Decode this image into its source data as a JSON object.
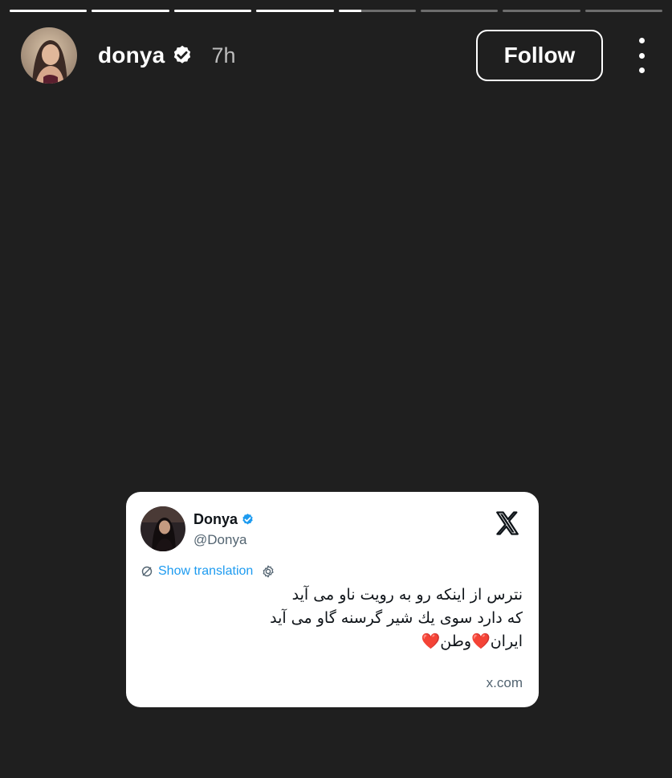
{
  "story": {
    "segments": [
      1,
      1,
      1,
      1,
      0.3,
      0,
      0,
      0
    ],
    "header": {
      "username": "donya",
      "time": "7h",
      "follow_label": "Follow",
      "avatar_icon": "profile-photo",
      "verified_icon": "verified-badge-icon",
      "more_icon": "more-vertical-icon"
    }
  },
  "tweet_card": {
    "name": "Donya",
    "handle": "@Donya",
    "show_translation": "Show translation",
    "lines": [
      "نترس از اینکه رو به رویت ناو  می آید",
      "که دارد سوی یك شیر گرسنه گاو می آید",
      "ایران❤️وطن❤️"
    ],
    "domain": "x.com",
    "x_logo_icon": "x-logo-icon"
  },
  "colors": {
    "background": "#1f1f1f",
    "card": "#ffffff",
    "link_blue": "#1d9bf0",
    "verified_blue": "#1d9bf0",
    "muted": "#536471"
  }
}
